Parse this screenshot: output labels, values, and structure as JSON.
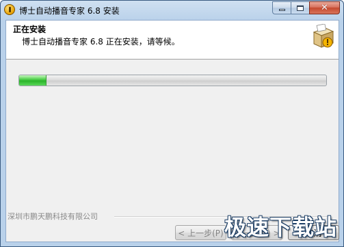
{
  "window": {
    "title": "博士自动播音专家 6.8 安装"
  },
  "header": {
    "title": "正在安装",
    "subtitle": "博士自动播音专家 6.8 正在安装，请等候。"
  },
  "progress": {
    "fraction": 0.09
  },
  "footer": {
    "brand": "深圳市鹏天鹏科技有限公司",
    "back_label": "< 上一步(P)",
    "next_label": "下一步(N) >",
    "cancel_label": "取消"
  },
  "watermark": {
    "text": "极速下载站"
  },
  "colors": {
    "progress_green": "#2bb52a",
    "titlebar_blue": "#b9d1ea",
    "close_red": "#c44a2f"
  }
}
